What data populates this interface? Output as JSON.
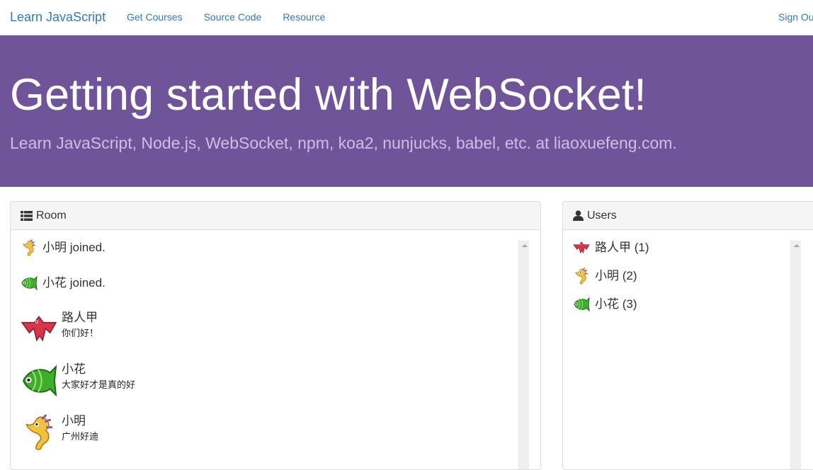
{
  "navbar": {
    "brand": "Learn JavaScript",
    "links": [
      "Get Courses",
      "Source Code",
      "Resource"
    ],
    "signout": "Sign Out"
  },
  "jumbotron": {
    "title": "Getting started with WebSocket!",
    "subtitle": "Learn JavaScript, Node.js, WebSocket, npm, koa2, nunjucks, babel, etc. at liaoxuefeng.com."
  },
  "room": {
    "heading": "Room",
    "heading_icon": "list-icon",
    "events": [
      {
        "avatar": "seahorse-avatar",
        "text": "小明 joined."
      },
      {
        "avatar": "fish-avatar",
        "text": "小花 joined."
      }
    ],
    "messages": [
      {
        "avatar": "bird-avatar",
        "name": "路人甲",
        "text": "你们好！"
      },
      {
        "avatar": "fish-avatar",
        "name": "小花",
        "text": "大家好才是真的好"
      },
      {
        "avatar": "seahorse-avatar",
        "name": "小明",
        "text": "广州好迪"
      }
    ]
  },
  "users": {
    "heading": "Users",
    "heading_icon": "user-icon",
    "list": [
      {
        "avatar": "bird-avatar",
        "label": "路人甲 (1)"
      },
      {
        "avatar": "seahorse-avatar",
        "label": "小明 (2)"
      },
      {
        "avatar": "fish-avatar",
        "label": "小花 (3)"
      }
    ]
  },
  "colors": {
    "brand_link": "#337ab7",
    "jumbotron_bg": "#6f5499",
    "jumbotron_subtitle": "#cdbfe3",
    "panel_heading_bg": "#f5f5f5"
  }
}
